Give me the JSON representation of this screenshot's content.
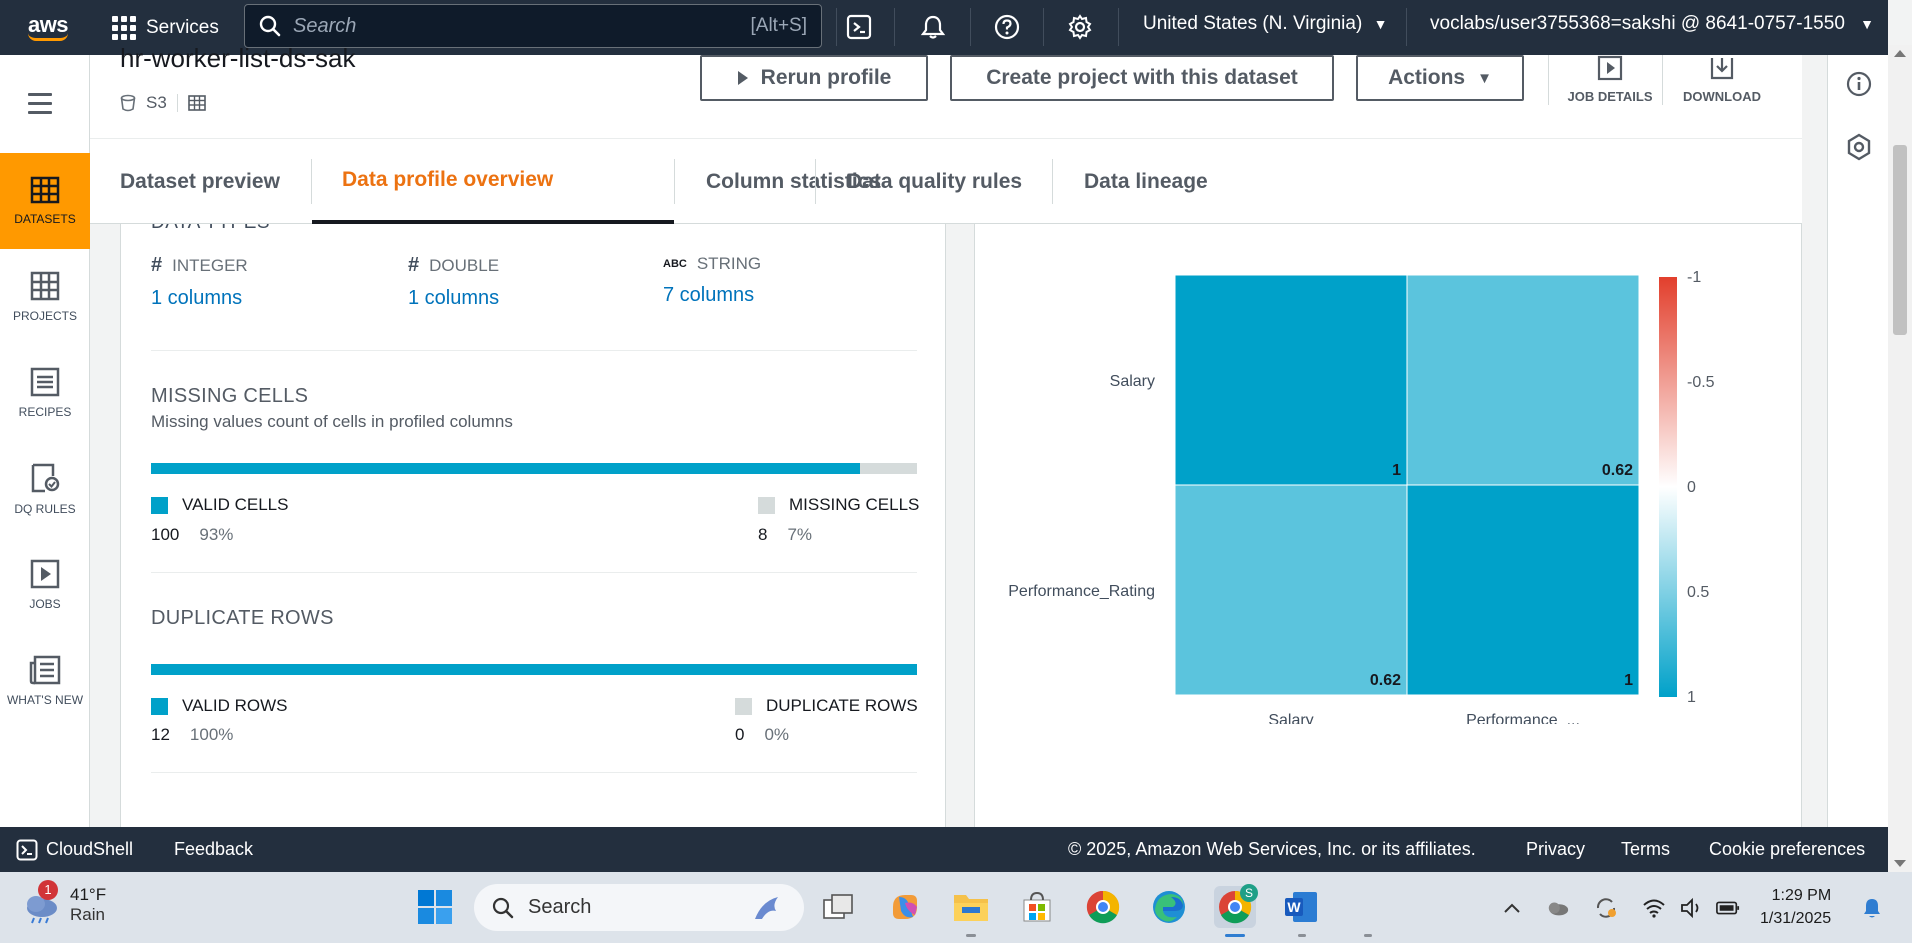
{
  "topnav": {
    "logo": "aws",
    "services_label": "Services",
    "search_placeholder": "Search",
    "search_shortcut": "[Alt+S]",
    "region": "United States (N. Virginia)",
    "account": "voclabs/user3755368=sakshi @ 8641-0757-1550"
  },
  "leftrail": {
    "items": [
      {
        "label": "DATASETS",
        "icon": "table-icon",
        "active": true
      },
      {
        "label": "PROJECTS",
        "icon": "grid-icon"
      },
      {
        "label": "RECIPES",
        "icon": "list-icon"
      },
      {
        "label": "DQ RULES",
        "icon": "clipboard-check-icon"
      },
      {
        "label": "JOBS",
        "icon": "play-icon"
      },
      {
        "label": "WHAT'S NEW",
        "icon": "newspaper-icon"
      }
    ]
  },
  "header": {
    "dataset_name": "hr-worker-list-ds-sak",
    "source": "S3",
    "rerun_label": "Rerun profile",
    "create_project_label": "Create project with this dataset",
    "actions_label": "Actions",
    "job_details_label": "JOB DETAILS",
    "download_label": "DOWNLOAD"
  },
  "tabs": [
    {
      "label": "Dataset preview"
    },
    {
      "label": "Data profile overview",
      "active": true
    },
    {
      "label": "Column statistics"
    },
    {
      "label": "Data quality rules"
    },
    {
      "label": "Data lineage"
    }
  ],
  "data_types": {
    "title": "DATA TYPES",
    "types": [
      {
        "symbol": "#",
        "name": "INTEGER",
        "count": "1 columns"
      },
      {
        "symbol": "#",
        "name": "DOUBLE",
        "count": "1 columns"
      },
      {
        "symbol": "ABC",
        "name": "STRING",
        "count": "7 columns"
      }
    ]
  },
  "missing_cells": {
    "title": "MISSING CELLS",
    "subtitle": "Missing values count of cells in profiled columns",
    "valid_fraction": 0.926,
    "valid_label": "VALID CELLS",
    "valid_count": "100",
    "valid_pct": "93%",
    "missing_label": "MISSING CELLS",
    "missing_count": "8",
    "missing_pct": "7%"
  },
  "duplicate_rows": {
    "title": "DUPLICATE ROWS",
    "valid_fraction": 1.0,
    "valid_label": "VALID ROWS",
    "valid_count": "12",
    "valid_pct": "100%",
    "dup_label": "DUPLICATE ROWS",
    "dup_count": "0",
    "dup_pct": "0%"
  },
  "colors": {
    "valid": "#00a1c9",
    "missing": "#d5dbdb",
    "accent": "#ec7211",
    "link": "#0073bb",
    "nav": "#232f3e",
    "rail_active": "#ff9900"
  },
  "chart_data": {
    "type": "heatmap",
    "rows": [
      "Salary",
      "Performance_Rating"
    ],
    "columns": [
      "Salary",
      "Performance_..."
    ],
    "values": [
      [
        1,
        0.62
      ],
      [
        0.62,
        1
      ]
    ],
    "colorbar": {
      "range": [
        -1,
        1
      ],
      "ticks": [
        "-1",
        "-0.5",
        "0",
        "0.5",
        "1"
      ]
    }
  },
  "footer": {
    "cloudshell": "CloudShell",
    "feedback": "Feedback",
    "copyright": "© 2025, Amazon Web Services, Inc. or its affiliates.",
    "privacy": "Privacy",
    "terms": "Terms",
    "cookies": "Cookie preferences"
  },
  "taskbar": {
    "weather_temp": "41°F",
    "weather_desc": "Rain",
    "weather_badge": "1",
    "search_label": "Search",
    "time": "1:29 PM",
    "date": "1/31/2025",
    "chrome_badge": "S"
  }
}
